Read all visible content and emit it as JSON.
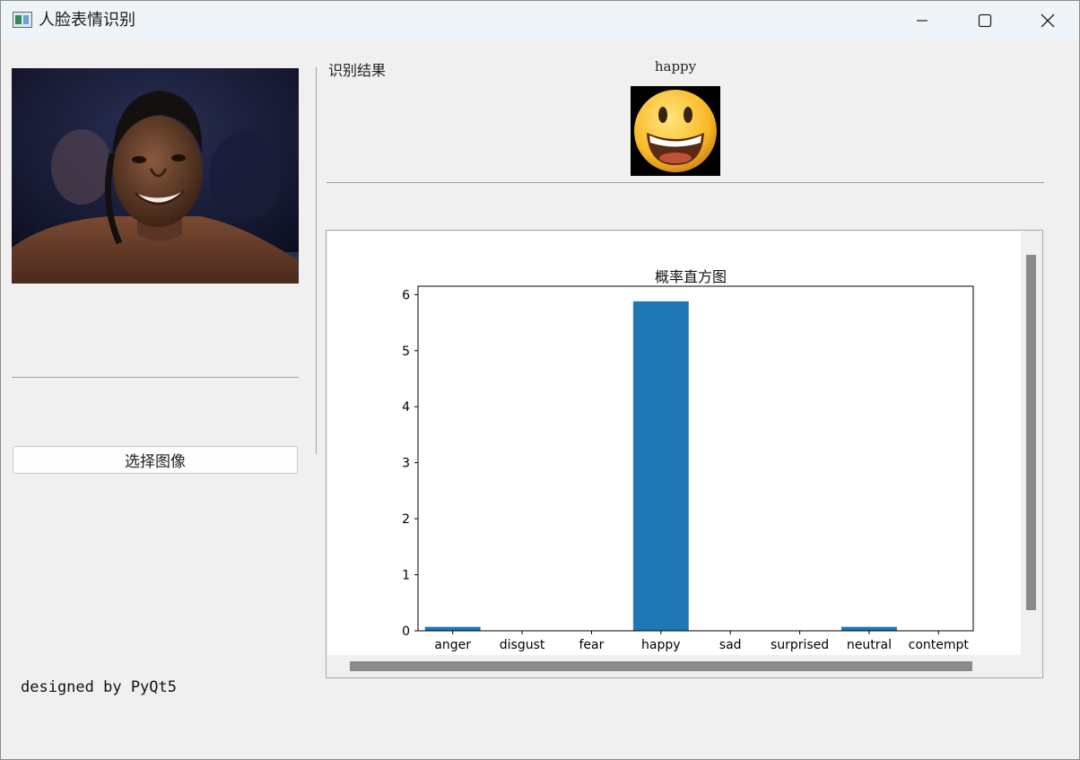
{
  "window": {
    "title": "人脸表情识别"
  },
  "left_panel": {
    "select_button_label": "选择图像",
    "footer_text": "designed by PyQt5"
  },
  "result": {
    "label": "识别结果",
    "emotion": "happy"
  },
  "chart_data": {
    "type": "bar",
    "title": "概率直方图",
    "xlabel": "",
    "ylabel": "",
    "categories": [
      "anger",
      "disgust",
      "fear",
      "happy",
      "sad",
      "surprised",
      "neutral",
      "contempt"
    ],
    "values": [
      0.07,
      0.0,
      0.0,
      5.88,
      0.0,
      0.0,
      0.07,
      0.0
    ],
    "ylim": [
      0,
      6.15
    ],
    "yticks": [
      0,
      1,
      2,
      3,
      4,
      5,
      6
    ],
    "bar_color": "#1f77b4",
    "grid": false
  }
}
